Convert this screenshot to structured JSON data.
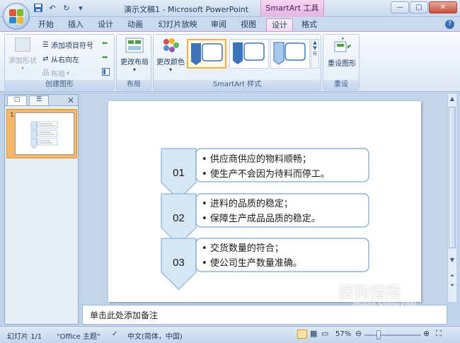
{
  "window": {
    "title": "演示文稿1 - Microsoft PowerPoint",
    "contextual_tab_group": "SmartArt 工具",
    "controls": {
      "minimize": "—",
      "maximize": "□",
      "close": "✕"
    }
  },
  "quick_access": {
    "save_icon": "save-icon",
    "undo": "↶",
    "redo": "↻"
  },
  "tabs": [
    {
      "label": "开始"
    },
    {
      "label": "插入"
    },
    {
      "label": "设计"
    },
    {
      "label": "动画"
    },
    {
      "label": "幻灯片放映"
    },
    {
      "label": "审阅"
    },
    {
      "label": "视图"
    },
    {
      "label": "设计",
      "active": true
    },
    {
      "label": "格式"
    }
  ],
  "ribbon": {
    "create_graphic": {
      "label": "创建图形",
      "add_shape": "添加形状",
      "add_bullet": "添加项目符号",
      "right_to_left": "从右向左",
      "layout": "布局"
    },
    "layouts": {
      "label": "布局",
      "change_layout": "更改布局"
    },
    "smartart_styles": {
      "label": "SmartArt 样式",
      "change_colors": "更改颜色"
    },
    "reset": {
      "label": "重设",
      "reset_graphic": "重设图形"
    }
  },
  "slides_pane": {
    "slide_number": "1"
  },
  "slide": {
    "items": [
      {
        "number": "01",
        "bullets": [
          "供应商供应的物料顺畅；",
          "使生产不会因为待料而停工。"
        ]
      },
      {
        "number": "02",
        "bullets": [
          "进料的品质的稳定；",
          "保障生产成品品质的稳定。"
        ]
      },
      {
        "number": "03",
        "bullets": [
          "交货数量的符合；",
          "使公司生产数量准确。"
        ]
      }
    ]
  },
  "notes": {
    "placeholder": "单击此处添加备注"
  },
  "statusbar": {
    "slide_info": "幻灯片 1/1",
    "theme": "\"Office 主题\"",
    "language": "中文(简体，中国)",
    "zoom": "57%"
  },
  "watermark": {
    "text": "搜狗指南",
    "sub": "zhinan.sogou.com"
  },
  "colors": {
    "chevron_fill": "#d6e6f5",
    "chevron_stroke": "#8db3dd",
    "box_stroke": "#7ba3d4",
    "contextual_tab": "#f0dbf0"
  }
}
